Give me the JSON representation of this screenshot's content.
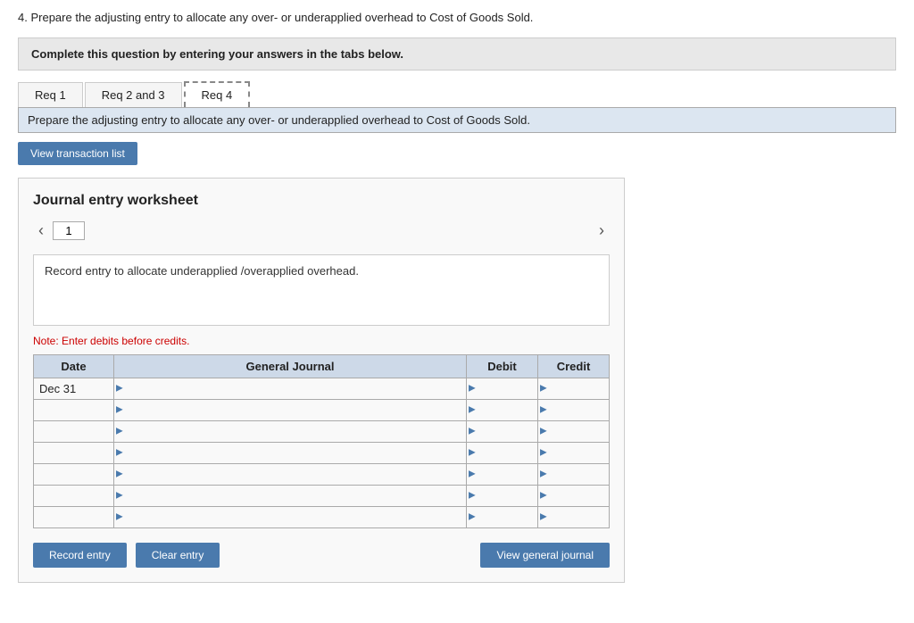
{
  "question": {
    "number": "4.",
    "text": "Prepare the adjusting entry to allocate any over- or underapplied overhead to Cost of Goods Sold."
  },
  "complete_box": {
    "text": "Complete this question by entering your answers in the tabs below."
  },
  "tabs": [
    {
      "label": "Req 1",
      "active": false
    },
    {
      "label": "Req 2 and 3",
      "active": false
    },
    {
      "label": "Req 4",
      "active": true
    }
  ],
  "tab_content_header": "Prepare the adjusting entry to allocate any over- or underapplied overhead to Cost of Goods Sold.",
  "buttons": {
    "view_transaction": "View transaction list",
    "record_entry": "Record entry",
    "clear_entry": "Clear entry",
    "view_general_journal": "View general journal"
  },
  "worksheet": {
    "title": "Journal entry worksheet",
    "page": "1",
    "description": "Record entry to allocate underapplied /overapplied overhead.",
    "note": "Note: Enter debits before credits.",
    "table": {
      "headers": [
        "Date",
        "General Journal",
        "Debit",
        "Credit"
      ],
      "rows": [
        {
          "date": "Dec 31",
          "journal": "",
          "debit": "",
          "credit": ""
        },
        {
          "date": "",
          "journal": "",
          "debit": "",
          "credit": ""
        },
        {
          "date": "",
          "journal": "",
          "debit": "",
          "credit": ""
        },
        {
          "date": "",
          "journal": "",
          "debit": "",
          "credit": ""
        },
        {
          "date": "",
          "journal": "",
          "debit": "",
          "credit": ""
        },
        {
          "date": "",
          "journal": "",
          "debit": "",
          "credit": ""
        },
        {
          "date": "",
          "journal": "",
          "debit": "",
          "credit": ""
        }
      ]
    }
  }
}
